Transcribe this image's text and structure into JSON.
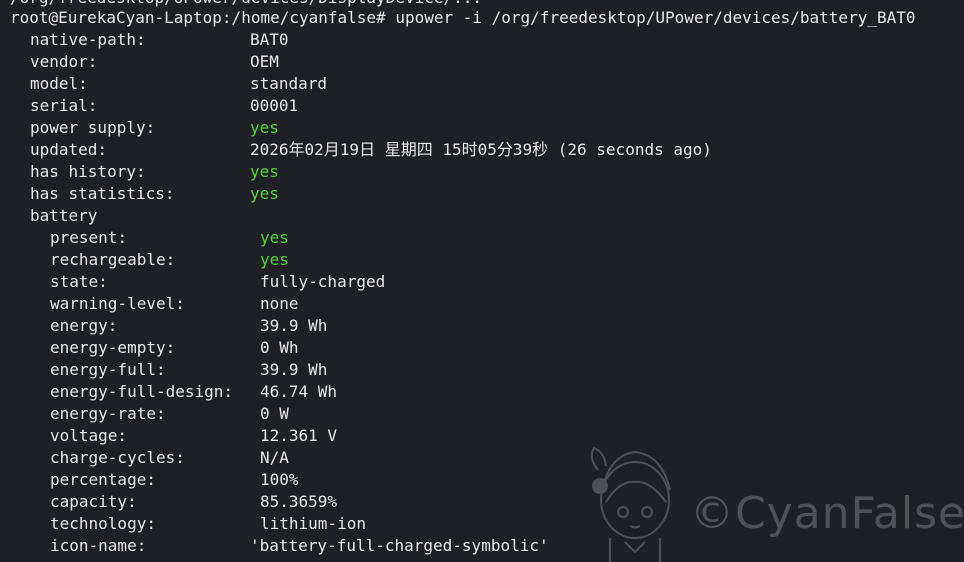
{
  "terminal": {
    "previous_line_fragment": "/org/freedesktop/UPower/devices/DisplayDevice/...",
    "prompt": "root@EurekaCyan-Laptop:/home/cyanfalse#",
    "command": " upower -i /org/freedesktop/UPower/devices/battery_BAT0",
    "device": [
      {
        "key": "native-path:",
        "value": "BAT0",
        "color": "#e9e9ea"
      },
      {
        "key": "vendor:",
        "value": "OEM",
        "color": "#e9e9ea"
      },
      {
        "key": "model:",
        "value": "standard",
        "color": "#e9e9ea"
      },
      {
        "key": "serial:",
        "value": "00001",
        "color": "#e9e9ea"
      },
      {
        "key": "power supply:",
        "value": "yes",
        "color": "#55d23d"
      },
      {
        "key": "updated:",
        "value": "2026年02月19日 星期四 15时05分39秒 (26 seconds ago)",
        "color": "#e9e9ea"
      },
      {
        "key": "has history:",
        "value": "yes",
        "color": "#55d23d"
      },
      {
        "key": "has statistics:",
        "value": "yes",
        "color": "#55d23d"
      }
    ],
    "battery_section_label": "battery",
    "battery": [
      {
        "key": "present:",
        "value": "yes",
        "color": "#55d23d"
      },
      {
        "key": "rechargeable:",
        "value": "yes",
        "color": "#55d23d"
      },
      {
        "key": "state:",
        "value": "fully-charged",
        "color": "#e9e9ea"
      },
      {
        "key": "warning-level:",
        "value": "none",
        "color": "#e9e9ea"
      },
      {
        "key": "energy:",
        "value": "39.9 Wh",
        "color": "#e9e9ea"
      },
      {
        "key": "energy-empty:",
        "value": "0 Wh",
        "color": "#e9e9ea"
      },
      {
        "key": "energy-full:",
        "value": "39.9 Wh",
        "color": "#e9e9ea"
      },
      {
        "key": "energy-full-design:",
        "value": "46.74 Wh",
        "color": "#e9e9ea"
      },
      {
        "key": "energy-rate:",
        "value": "0 W",
        "color": "#e9e9ea"
      },
      {
        "key": "voltage:",
        "value": "12.361 V",
        "color": "#e9e9ea"
      },
      {
        "key": "charge-cycles:",
        "value": "N/A",
        "color": "#e9e9ea"
      },
      {
        "key": "percentage:",
        "value": "100%",
        "color": "#e9e9ea"
      },
      {
        "key": "capacity:",
        "value": "85.3659%",
        "color": "#e9e9ea"
      },
      {
        "key": "technology:",
        "value": "lithium-ion",
        "color": "#e9e9ea"
      },
      {
        "key": "icon-name:",
        "value": "'battery-full-charged-symbolic'",
        "color": "#e9e9ea"
      }
    ]
  },
  "watermark": {
    "text": "©CyanFalse"
  },
  "colors": {
    "background": "#1f2026",
    "text": "#e9e9ea",
    "green": "#55d23d"
  }
}
